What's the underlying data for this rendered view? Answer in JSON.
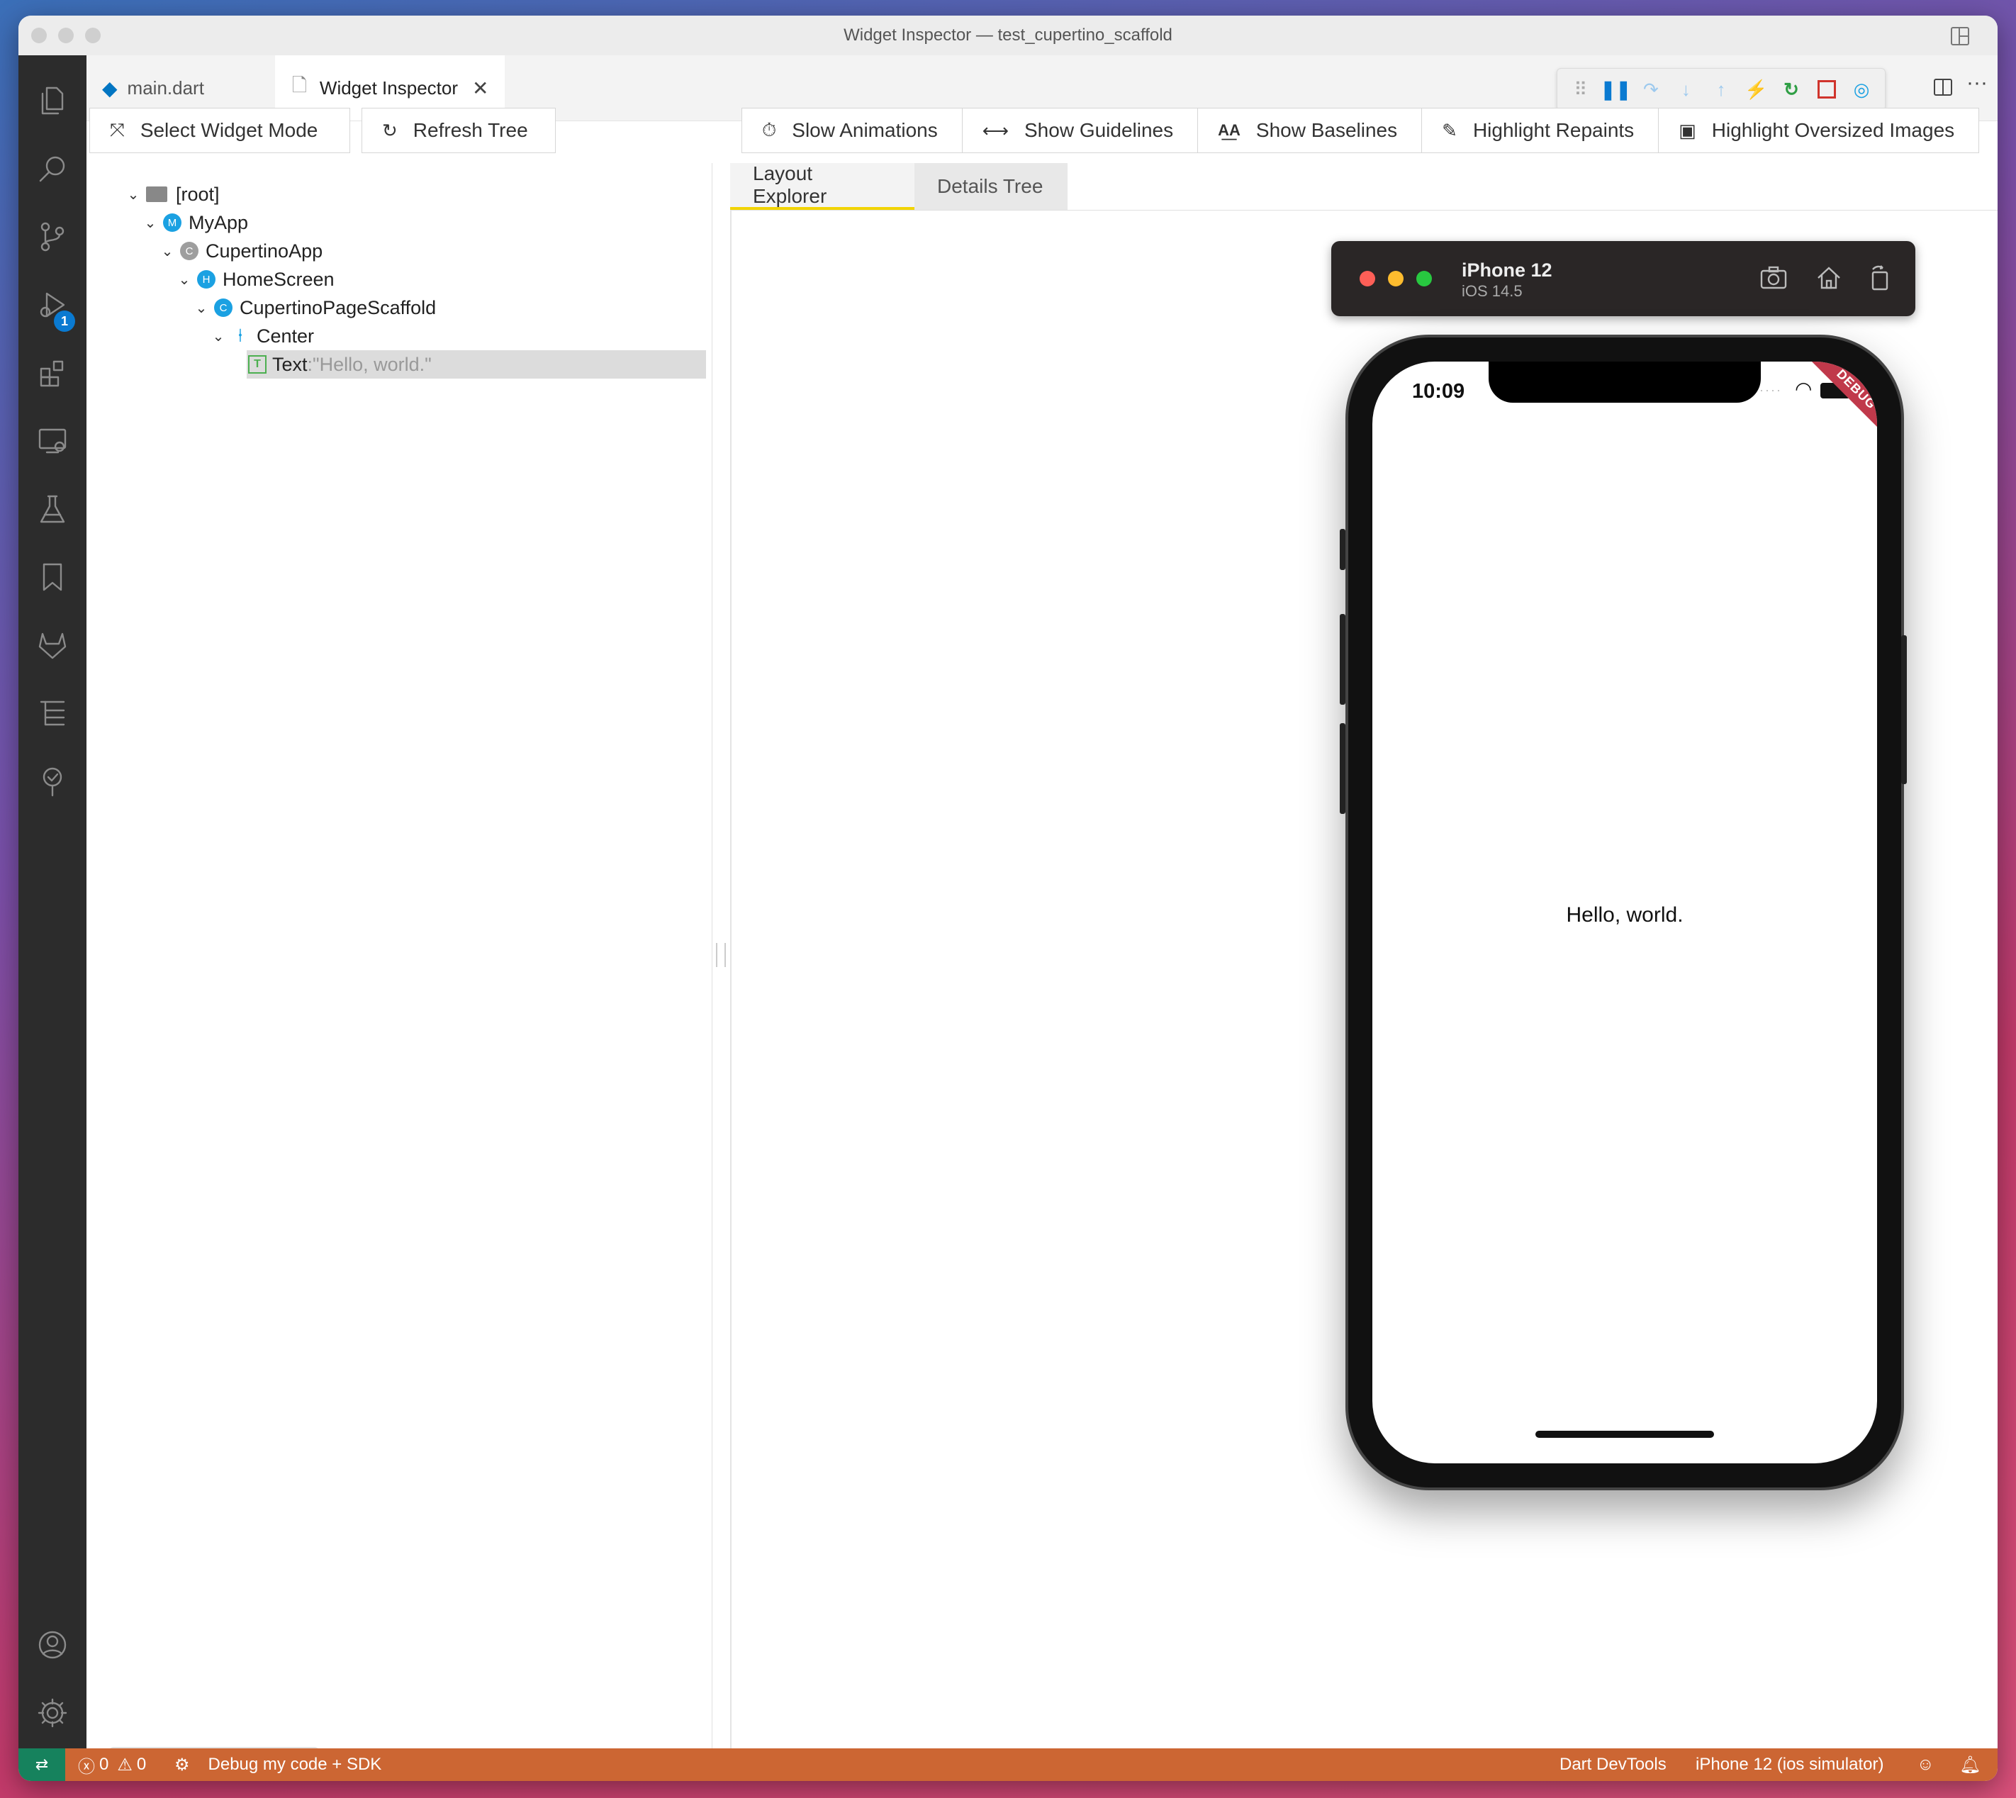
{
  "window": {
    "title": "Widget Inspector — test_cupertino_scaffold"
  },
  "activity_bar": {
    "debug_badge": "1"
  },
  "tabs": [
    {
      "label": "main.dart"
    },
    {
      "label": "Widget Inspector"
    }
  ],
  "toolbar": {
    "select_widget_mode": "Select Widget Mode",
    "refresh_tree": "Refresh Tree",
    "slow_animations": "Slow Animations",
    "show_guidelines": "Show Guidelines",
    "show_baselines": "Show Baselines",
    "highlight_repaints": "Highlight Repaints",
    "highlight_oversized_images": "Highlight Oversized Images"
  },
  "tree": {
    "root": "[root]",
    "my_app": {
      "label": "MyApp",
      "badge": "M"
    },
    "cupertino_app": {
      "label": "CupertinoApp",
      "badge": "C"
    },
    "home_screen": {
      "label": "HomeScreen",
      "badge": "H"
    },
    "scaffold": {
      "label": "CupertinoPageScaffold",
      "badge": "C"
    },
    "center": {
      "label": "Center"
    },
    "text": {
      "label": "Text",
      "sep": ": ",
      "value": "\"Hello, world.\"",
      "badge": "T"
    }
  },
  "right_tabs": {
    "layout_explorer": "Layout Explorer",
    "details_tree": "Details Tree"
  },
  "simulator": {
    "device": "iPhone 12",
    "os": "iOS 14.5",
    "time": "10:09",
    "banner": "DEBUG",
    "content": "Hello, world."
  },
  "status_bar": {
    "errors": "0",
    "warnings": "0",
    "debug_config": "Debug my code + SDK",
    "devtools": "Dart DevTools",
    "device": "iPhone 12 (ios simulator)"
  },
  "colors": {
    "status_bar": "#cc6633",
    "remote": "#16825d",
    "accent_tab": "#f2d400",
    "node_blue": "#1ba1e2",
    "node_gray": "#9e9e9e",
    "node_green": "#4caf50"
  }
}
